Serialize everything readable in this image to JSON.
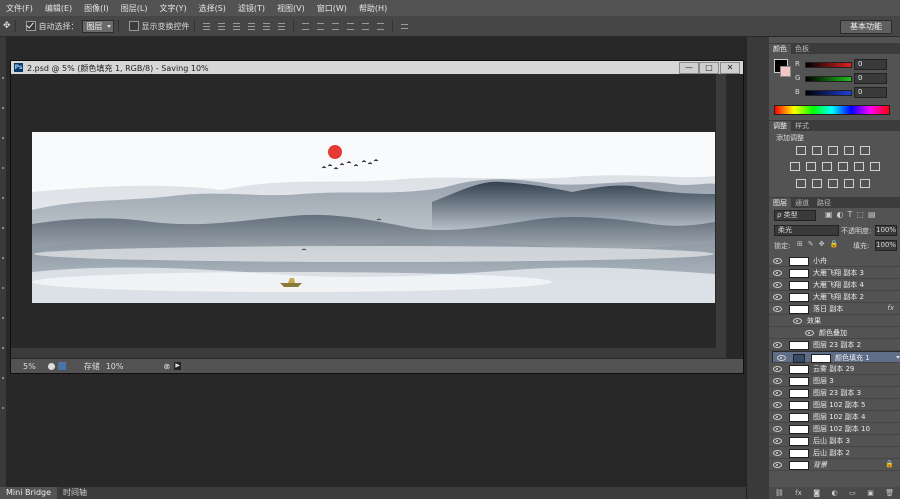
{
  "menu": [
    "文件(F)",
    "编辑(E)",
    "图像(I)",
    "图层(L)",
    "文字(Y)",
    "选择(S)",
    "滤镜(T)",
    "视图(V)",
    "窗口(W)",
    "帮助(H)"
  ],
  "options": {
    "auto_select_label": "自动选择：",
    "auto_select_value": "图层",
    "show_transform_label": "显示变换控件",
    "workspace": "基本功能"
  },
  "document": {
    "title": "2.psd @ 5% (颜色填充 1, RGB/8) - Saving 10%",
    "ps_badge": "Ps",
    "min": "—",
    "restore": "□",
    "close": "✕",
    "zoom": "5%",
    "save_label": "存储",
    "save_progress": "10%"
  },
  "bottom_tabs": [
    "Mini Bridge",
    "时间轴"
  ],
  "color_panel": {
    "tabs": [
      "颜色",
      "色板"
    ],
    "r_label": "R",
    "g_label": "G",
    "b_label": "B",
    "r": "0",
    "g": "0",
    "b": "0",
    "accent_red": "#e02020",
    "accent_green": "#20c020",
    "accent_blue": "#2040e0"
  },
  "adjust_panel": {
    "tabs": [
      "调整",
      "样式"
    ],
    "add_label": "添加调整"
  },
  "layers_panel": {
    "tabs": [
      "图层",
      "通道",
      "路径"
    ],
    "filter_kind": "ρ 类型",
    "blend_mode": "柔光",
    "opacity_label": "不透明度:",
    "opacity": "100%",
    "lock_label": "锁定:",
    "fill_label": "填充:",
    "fill": "100%",
    "layers": [
      {
        "name": "小舟"
      },
      {
        "name": "大雁飞翔 副本 3"
      },
      {
        "name": "大雁飞翔 副本 4"
      },
      {
        "name": "大雁飞翔 副本 2"
      },
      {
        "name": "落日 副本",
        "fx": "fx"
      },
      {
        "name": "效果",
        "sub": true
      },
      {
        "name": "颜色叠加",
        "sub": true
      },
      {
        "name": "图层 23 副本 2"
      },
      {
        "name": "颜色填充 1",
        "selected": true
      },
      {
        "name": "云雾 副本 29"
      },
      {
        "name": "图层 3"
      },
      {
        "name": "图层 23 副本 3"
      },
      {
        "name": "图层 102 副本 5"
      },
      {
        "name": "图层 102 副本 4"
      },
      {
        "name": "图层 102 副本 10"
      },
      {
        "name": "后山 副本 3"
      },
      {
        "name": "后山 副本 2"
      },
      {
        "name": "背景"
      }
    ]
  }
}
